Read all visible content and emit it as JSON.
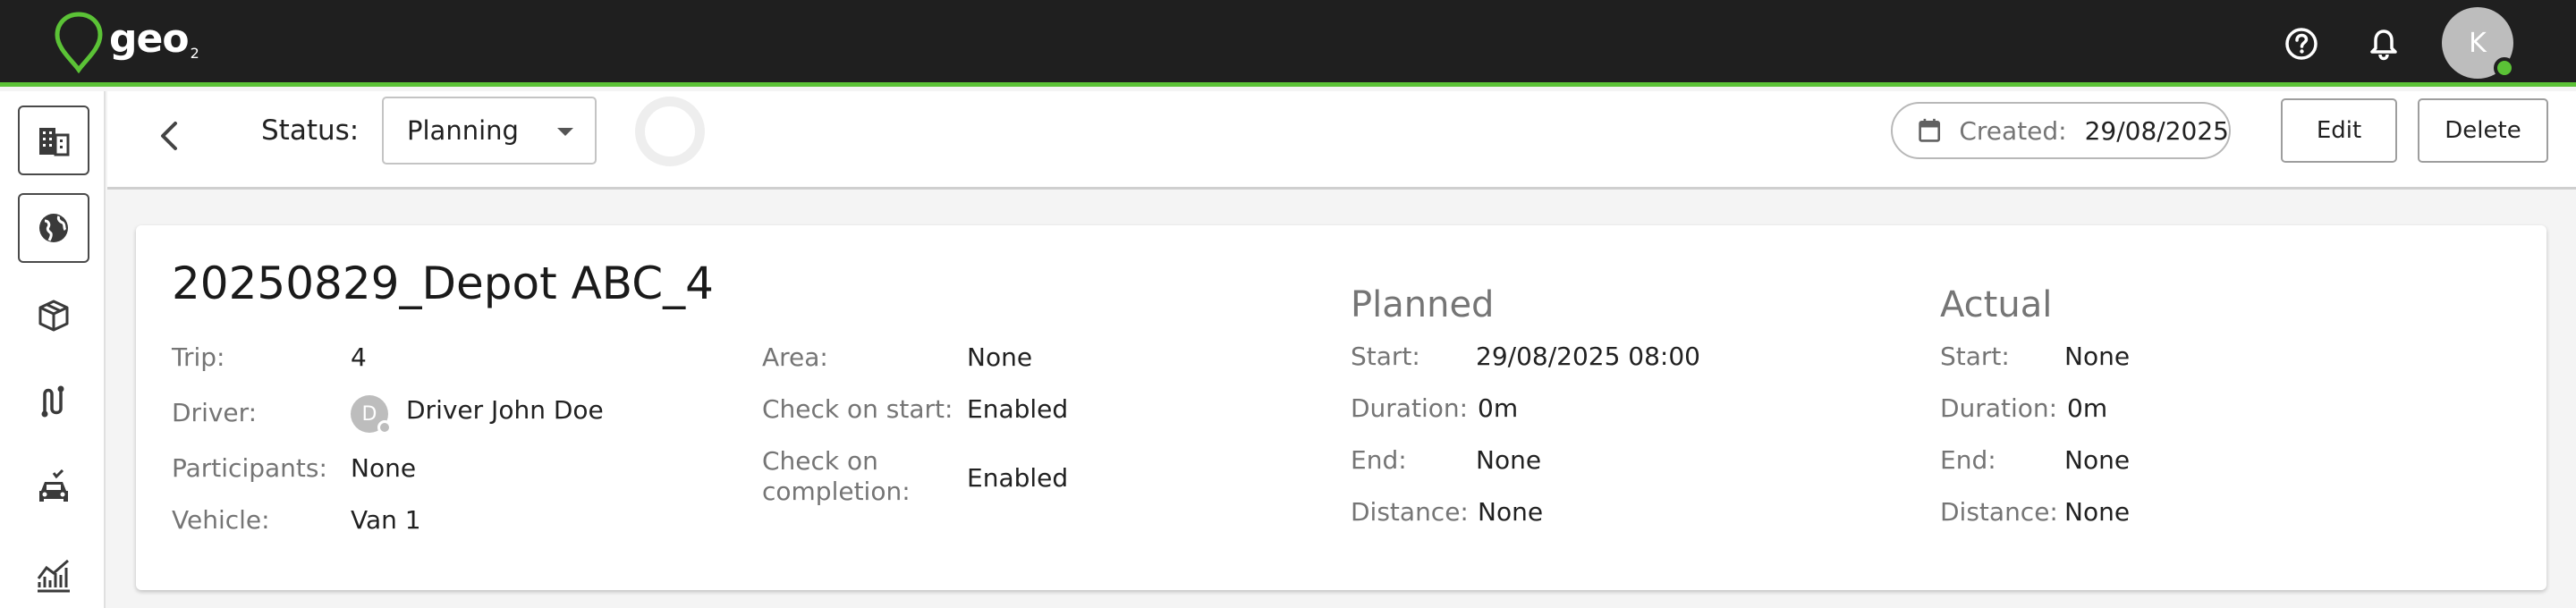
{
  "brand": {
    "logo_text": "geo",
    "logo_sub": "2",
    "accent": "#5bc236"
  },
  "header": {
    "help_icon": "help-circle-icon",
    "notifications_icon": "bell-icon",
    "user_initial": "K",
    "user_status_color": "#5bc236"
  },
  "sidebar": {
    "items": [
      {
        "name": "buildings",
        "icon": "building-icon",
        "selected": true
      },
      {
        "name": "globe",
        "icon": "globe-icon",
        "selected": true
      },
      {
        "name": "packages",
        "icon": "package-icon",
        "selected": false
      },
      {
        "name": "routes",
        "icon": "route-icon",
        "selected": false
      },
      {
        "name": "vehicles",
        "icon": "car-check-icon",
        "selected": false
      },
      {
        "name": "analytics",
        "icon": "chart-icon",
        "selected": false
      }
    ]
  },
  "toolbar": {
    "status_label": "Status:",
    "status_value": "Planning",
    "created_label": "Created:",
    "created_date": "29/08/2025",
    "edit_label": "Edit",
    "delete_label": "Delete"
  },
  "trip": {
    "title": "20250829_Depot ABC_4",
    "trip_label": "Trip:",
    "trip_value": "4",
    "driver_label": "Driver:",
    "driver_initial": "D",
    "driver_value": "Driver John Doe",
    "participants_label": "Participants:",
    "participants_value": "None",
    "vehicle_label": "Vehicle:",
    "vehicle_value": "Van 1",
    "area_label": "Area:",
    "area_value": "None",
    "check_start_label": "Check on start:",
    "check_start_value": "Enabled",
    "check_completion_label_1": "Check on",
    "check_completion_label_2": "completion:",
    "check_completion_value": "Enabled"
  },
  "planned": {
    "title": "Planned",
    "start_label": "Start:",
    "start_value": "29/08/2025 08:00",
    "duration_label": "Duration:",
    "duration_value": "0m",
    "end_label": "End:",
    "end_value": "None",
    "distance_label": "Distance:",
    "distance_value": "None"
  },
  "actual": {
    "title": "Actual",
    "start_label": "Start:",
    "start_value": "None",
    "duration_label": "Duration:",
    "duration_value": "0m",
    "end_label": "End:",
    "end_value": "None",
    "distance_label": "Distance:",
    "distance_value": "None"
  }
}
